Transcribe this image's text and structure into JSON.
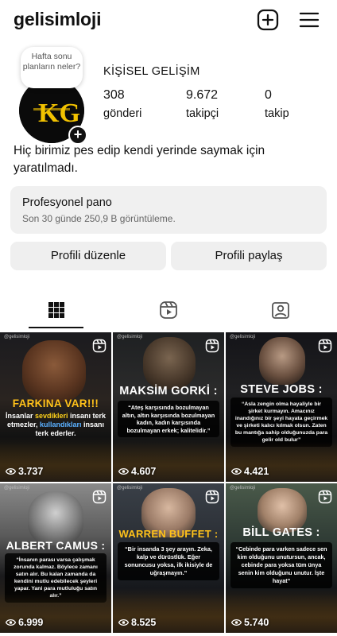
{
  "header": {
    "username": "gelisimloji"
  },
  "note": {
    "text": "Hafta sonu planların neler?"
  },
  "profile": {
    "name": "KİŞİSEL GELİŞİM",
    "avatar_text": "KG",
    "stats": [
      {
        "value": "308",
        "label": "gönderi"
      },
      {
        "value": "9.672",
        "label": "takipçi"
      },
      {
        "value": "0",
        "label": "takip"
      }
    ],
    "bio": "Hiç birimiz pes edip kendi yerinde saymak için yaratılmadı."
  },
  "dashboard": {
    "title": "Profesyonel pano",
    "subtitle": "Son 30 günde 250,9 B görüntüleme."
  },
  "buttons": {
    "edit": "Profili düzenle",
    "share": "Profili paylaş"
  },
  "tabs": [
    {
      "icon": "grid-icon"
    },
    {
      "icon": "reels-icon"
    },
    {
      "icon": "tagged-icon"
    }
  ],
  "posts": [
    {
      "title": "FARKINA VAR!!!",
      "quote": [
        "İnsanlar ",
        "sevdikleri",
        " insanı terk etmezler, ",
        "kullandıkları",
        " insanı terk ederler."
      ],
      "views": "3.737"
    },
    {
      "title": "MAKSİM GORKİ :",
      "quote": "“Ateş karşısında bozulmayan altın, altın karşısında bozulmayan kadın, kadın karşısında bozulmayan erkek; kalitelidir.”",
      "views": "4.607"
    },
    {
      "title": "STEVE JOBS :",
      "quote": "“Asla zengin olma hayaliyle bir şirket kurmayın. Amacınız inandığınız bir şeyi hayata geçirmek ve şirketi kalıcı kılmak olsun. Zaten bu mantığa sahip olduğunuzda para gelir old bulur”",
      "views": "4.421"
    },
    {
      "title": "ALBERT CAMUS :",
      "quote": "“İnsanın parası varsa çalışmak zorunda kalmaz. Böylece zamanı satın alır. Bu kalan zamanda da kendini mutlu edebilecek şeyleri yapar. Yani para mutluluğu satın alır.”",
      "views": "6.999"
    },
    {
      "title": "WARREN BUFFET :",
      "quote": "“Bir insanda 3 şey arayın. Zeka, kalp ve dürüstlük. Eğer sonuncusu yoksa, ilk ikisiyle de uğraşmayın.”",
      "views": "8.525"
    },
    {
      "title": "BİLL GATES :",
      "quote": "“Cebinde para varken sadece sen kim olduğunu unutursun, ancak, cebinde para yoksa tüm ünya senin kim olduğunu unutur. İşte hayat”",
      "views": "5.740"
    }
  ],
  "watermark": "@gelisimloji",
  "colors": {
    "accent_blue": "#5ab0ff",
    "accent_yellow": "#ffd21a",
    "button_bg": "#efefef"
  }
}
